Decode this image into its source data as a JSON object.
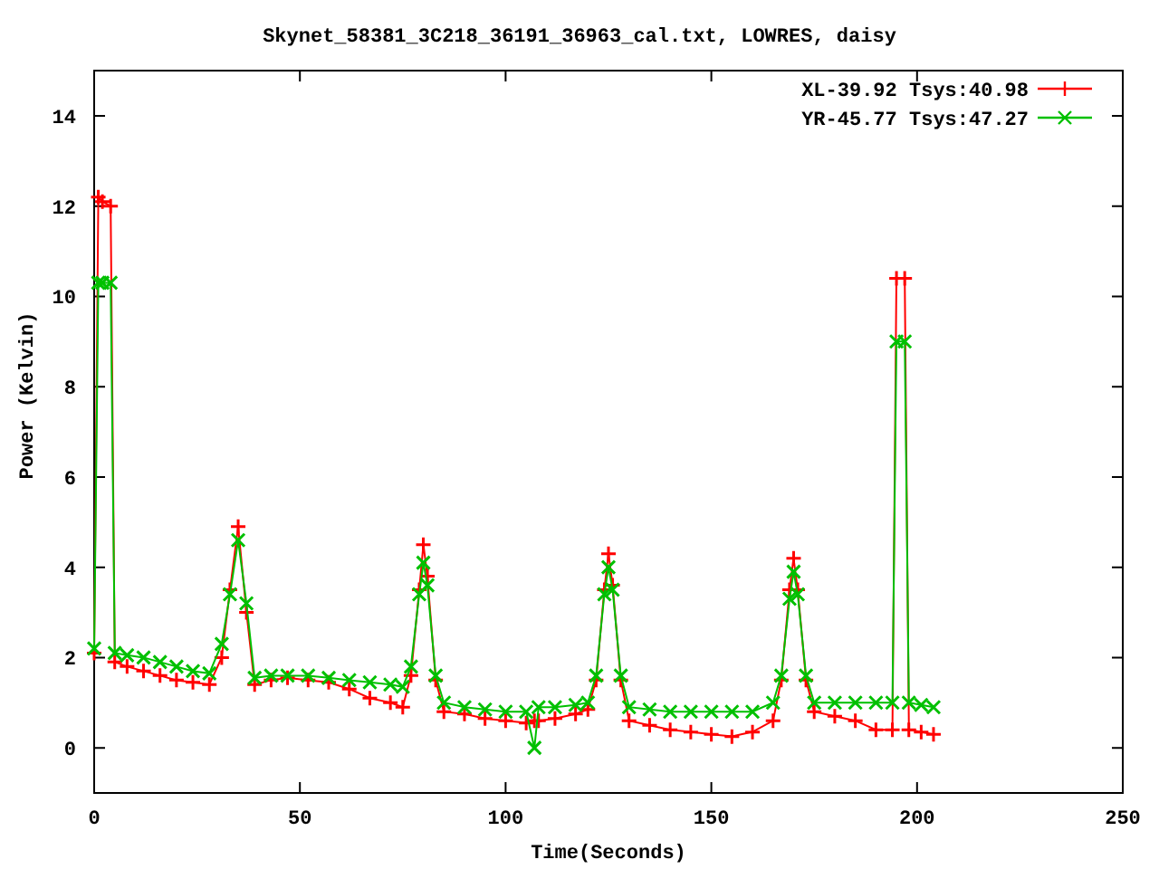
{
  "chart_data": {
    "type": "line",
    "title": "Skynet_58381_3C218_36191_36963_cal.txt, LOWRES, daisy",
    "xlabel": "Time(Seconds)",
    "ylabel": "Power (Kelvin)",
    "xlim": [
      0,
      250
    ],
    "ylim": [
      -1,
      15
    ],
    "xticks": [
      0,
      50,
      100,
      150,
      200,
      250
    ],
    "yticks": [
      0,
      2,
      4,
      6,
      8,
      10,
      12,
      14
    ],
    "legend": "upper right",
    "x": [
      0,
      1,
      2,
      4,
      5,
      8,
      12,
      16,
      20,
      24,
      28,
      31,
      33,
      35,
      37,
      39,
      43,
      47,
      52,
      57,
      62,
      67,
      72,
      75,
      77,
      79,
      80,
      81,
      83,
      85,
      90,
      95,
      100,
      105,
      107,
      108,
      112,
      117,
      120,
      122,
      124,
      125,
      126,
      128,
      130,
      135,
      140,
      145,
      150,
      155,
      160,
      165,
      167,
      169,
      170,
      171,
      173,
      175,
      180,
      185,
      190,
      194,
      195,
      197,
      198,
      201,
      204
    ],
    "series": [
      {
        "name": "XL-39.92 Tsys:40.98",
        "color": "#ff0000",
        "marker": "plus",
        "values": [
          2.1,
          12.2,
          12.1,
          12.0,
          1.9,
          1.8,
          1.7,
          1.6,
          1.5,
          1.45,
          1.4,
          2.0,
          3.5,
          4.9,
          3.0,
          1.4,
          1.5,
          1.55,
          1.5,
          1.45,
          1.3,
          1.1,
          1.0,
          0.9,
          1.6,
          3.5,
          4.5,
          3.8,
          1.5,
          0.8,
          0.75,
          0.65,
          0.6,
          0.55,
          0.6,
          0.6,
          0.65,
          0.75,
          0.85,
          1.5,
          3.5,
          4.3,
          3.6,
          1.5,
          0.6,
          0.5,
          0.4,
          0.35,
          0.3,
          0.25,
          0.35,
          0.6,
          1.5,
          3.5,
          4.2,
          3.5,
          1.5,
          0.8,
          0.7,
          0.6,
          0.4,
          0.4,
          10.4,
          10.4,
          0.4,
          0.35,
          0.3
        ]
      },
      {
        "name": "YR-45.77 Tsys:47.27",
        "color": "#00c000",
        "marker": "cross",
        "values": [
          2.2,
          10.3,
          10.3,
          10.3,
          2.1,
          2.05,
          2.0,
          1.9,
          1.8,
          1.7,
          1.65,
          2.3,
          3.4,
          4.6,
          3.2,
          1.55,
          1.6,
          1.6,
          1.6,
          1.55,
          1.5,
          1.45,
          1.4,
          1.35,
          1.8,
          3.4,
          4.1,
          3.6,
          1.6,
          1.0,
          0.9,
          0.85,
          0.8,
          0.8,
          0.0,
          0.9,
          0.9,
          0.95,
          1.0,
          1.6,
          3.4,
          4.0,
          3.5,
          1.6,
          0.9,
          0.85,
          0.8,
          0.8,
          0.8,
          0.8,
          0.8,
          1.0,
          1.6,
          3.3,
          3.9,
          3.4,
          1.6,
          1.0,
          1.0,
          1.0,
          1.0,
          1.0,
          9.0,
          9.0,
          1.0,
          0.95,
          0.9
        ]
      }
    ]
  }
}
